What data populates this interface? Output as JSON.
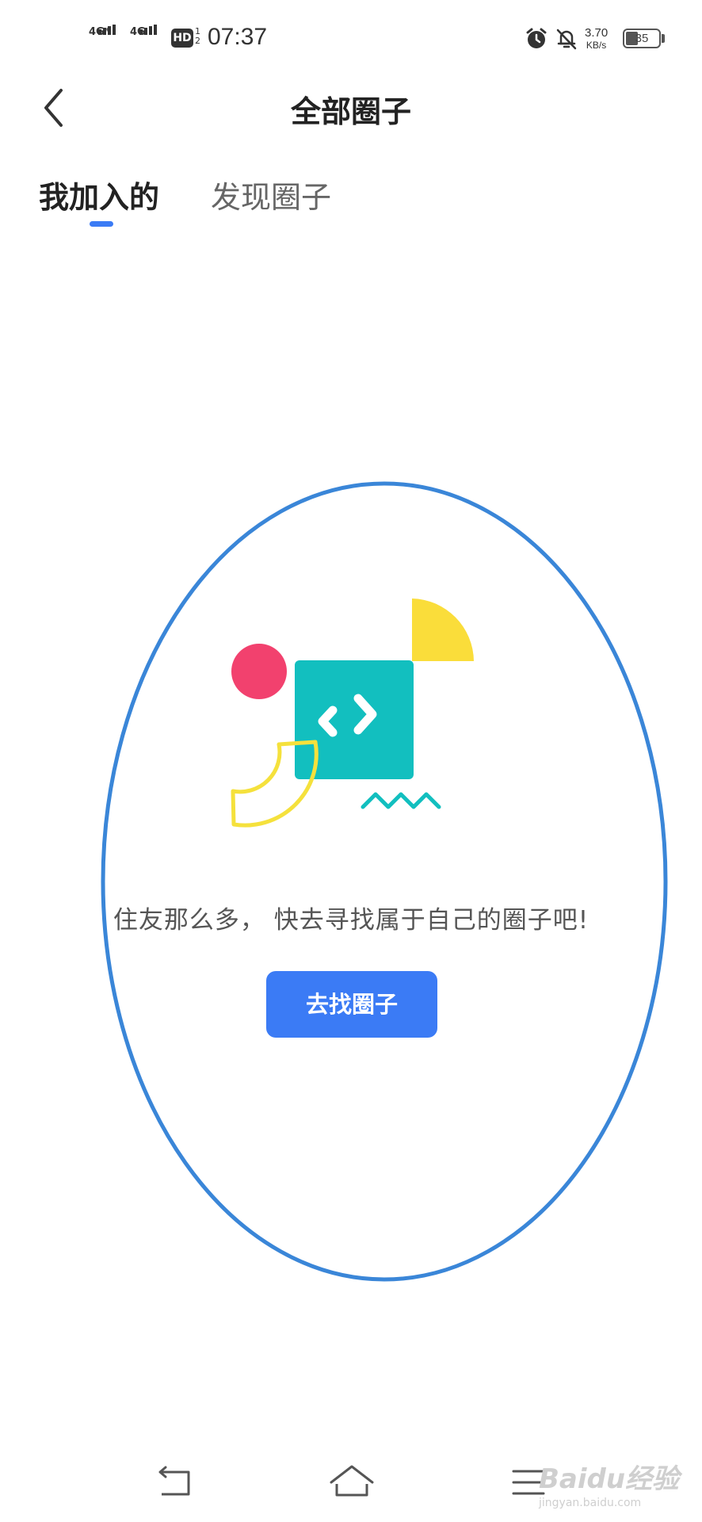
{
  "status_bar": {
    "network_1": "4G⁺",
    "network_2": "4G",
    "hd_badge": "HD",
    "sim_slot_top": "1",
    "sim_slot_bottom": "2",
    "time": "07:37",
    "speed_value": "3.70",
    "speed_unit": "KB/s",
    "battery_level": "35"
  },
  "header": {
    "title": "全部圈子"
  },
  "tabs": [
    {
      "label": "我加入的",
      "active": true
    },
    {
      "label": "发现圈子",
      "active": false
    }
  ],
  "empty_state": {
    "message": "住友那么多， 快去寻找属于自己的圈子吧!",
    "button_label": "去找圈子"
  },
  "watermark": {
    "brand": "Baidu经验",
    "url": "jingyan.baidu.com"
  },
  "colors": {
    "accent": "#3b7bf5",
    "teal": "#12bfbf",
    "pink": "#f2416e",
    "yellow": "#fadd3a",
    "annotation_circle": "#3a86d8"
  }
}
